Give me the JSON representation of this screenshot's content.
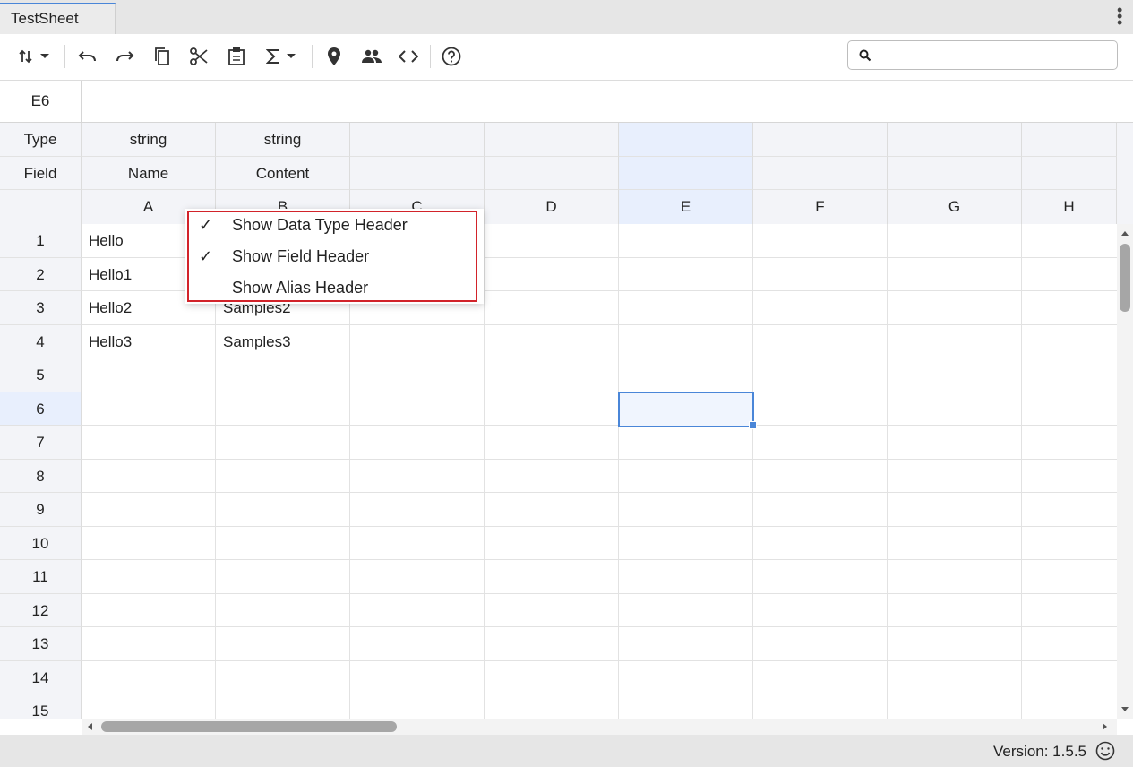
{
  "app": {
    "tab_title": "TestSheet",
    "version_label": "Version: 1.5.5"
  },
  "search": {
    "placeholder": "",
    "value": ""
  },
  "formula_bar": {
    "cell_ref": "E6",
    "content": ""
  },
  "header_rows": {
    "type_label": "Type",
    "field_label": "Field"
  },
  "columns": [
    {
      "letter": "A",
      "type": "string",
      "field": "Name"
    },
    {
      "letter": "B",
      "type": "string",
      "field": "Content"
    },
    {
      "letter": "C",
      "type": "",
      "field": ""
    },
    {
      "letter": "D",
      "type": "",
      "field": ""
    },
    {
      "letter": "E",
      "type": "",
      "field": ""
    },
    {
      "letter": "F",
      "type": "",
      "field": ""
    },
    {
      "letter": "G",
      "type": "",
      "field": ""
    },
    {
      "letter": "H",
      "type": "",
      "field": ""
    }
  ],
  "rows": [
    {
      "num": "1",
      "cells": [
        "Hello",
        ""
      ]
    },
    {
      "num": "2",
      "cells": [
        "Hello1",
        ""
      ]
    },
    {
      "num": "3",
      "cells": [
        "Hello2",
        "Samples2"
      ]
    },
    {
      "num": "4",
      "cells": [
        "Hello3",
        "Samples3"
      ]
    },
    {
      "num": "5",
      "cells": [
        "",
        ""
      ]
    },
    {
      "num": "6",
      "cells": [
        "",
        ""
      ]
    },
    {
      "num": "7",
      "cells": [
        "",
        ""
      ]
    },
    {
      "num": "8",
      "cells": [
        "",
        ""
      ]
    },
    {
      "num": "9",
      "cells": [
        "",
        ""
      ]
    },
    {
      "num": "10",
      "cells": [
        "",
        ""
      ]
    },
    {
      "num": "11",
      "cells": [
        "",
        ""
      ]
    },
    {
      "num": "12",
      "cells": [
        "",
        ""
      ]
    },
    {
      "num": "13",
      "cells": [
        "",
        ""
      ]
    },
    {
      "num": "14",
      "cells": [
        "",
        ""
      ]
    },
    {
      "num": "15",
      "cells": [
        "",
        ""
      ]
    }
  ],
  "selection": {
    "column": "E",
    "row": "6"
  },
  "context_menu": {
    "items": [
      {
        "label": "Show Data Type Header",
        "checked": true,
        "check_glyph": "✓"
      },
      {
        "label": "Show Field Header",
        "checked": true,
        "check_glyph": "✓"
      },
      {
        "label": "Show Alias Header",
        "checked": false,
        "check_glyph": ""
      }
    ]
  },
  "toolbar_icons": [
    "sort-icon",
    "dropdown-icon",
    "undo-icon",
    "redo-icon",
    "copy-icon",
    "cut-icon",
    "paste-icon",
    "sum-icon",
    "dropdown-icon",
    "location-pin-icon",
    "people-icon",
    "code-icon",
    "help-icon"
  ],
  "colors": {
    "accent": "#4a86d8",
    "selection_header": "#e8effd",
    "highlight_border": "#d2232a",
    "header_bg": "#f3f4f8"
  }
}
